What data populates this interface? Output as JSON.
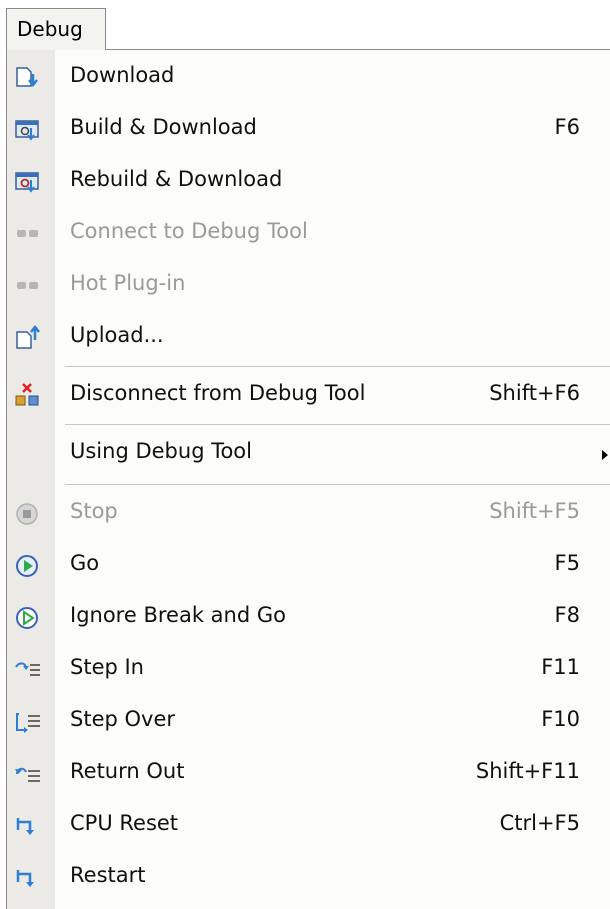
{
  "menu_title": "Debug",
  "items": [
    {
      "label": "Download",
      "shortcut": "",
      "icon": "download-icon"
    },
    {
      "label": "Build & Download",
      "shortcut": "F6",
      "icon": "build-download-icon"
    },
    {
      "label": "Rebuild & Download",
      "shortcut": "",
      "icon": "rebuild-download-icon"
    },
    {
      "label": "Connect to Debug Tool",
      "shortcut": "",
      "icon": "connect-icon",
      "disabled": true
    },
    {
      "label": "Hot Plug-in",
      "shortcut": "",
      "icon": "hot-plug-icon",
      "disabled": true
    },
    {
      "label": "Upload...",
      "shortcut": "",
      "icon": "upload-icon"
    },
    {
      "label": "Disconnect from Debug Tool",
      "shortcut": "Shift+F6",
      "icon": "disconnect-icon"
    },
    {
      "label": "Using Debug Tool",
      "shortcut": "",
      "icon": "",
      "submenu": true
    },
    {
      "label": "Stop",
      "shortcut": "Shift+F5",
      "icon": "stop-icon",
      "disabled": true
    },
    {
      "label": "Go",
      "shortcut": "F5",
      "icon": "go-icon"
    },
    {
      "label": "Ignore Break and Go",
      "shortcut": "F8",
      "icon": "ignore-break-go-icon"
    },
    {
      "label": "Step In",
      "shortcut": "F11",
      "icon": "step-in-icon"
    },
    {
      "label": "Step Over",
      "shortcut": "F10",
      "icon": "step-over-icon"
    },
    {
      "label": "Return Out",
      "shortcut": "Shift+F11",
      "icon": "return-out-icon"
    },
    {
      "label": "CPU Reset",
      "shortcut": "Ctrl+F5",
      "icon": "cpu-reset-icon"
    },
    {
      "label": "Restart",
      "shortcut": "",
      "icon": "restart-icon"
    }
  ]
}
